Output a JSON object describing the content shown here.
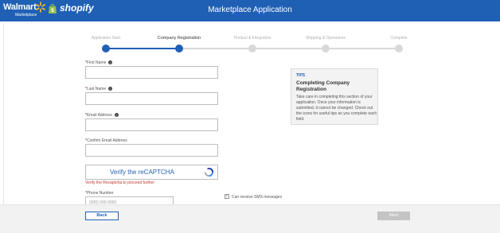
{
  "header": {
    "walmart_text": "Walmart",
    "walmart_sub": "Marketplace",
    "shopify_text": "shopify",
    "title": "Marketplace Application",
    "bg_color": "#1f60b5"
  },
  "steps": [
    {
      "label": "Application Start",
      "state": "done"
    },
    {
      "label": "Company Registration",
      "state": "active"
    },
    {
      "label": "Product & Integration",
      "state": "pending"
    },
    {
      "label": "Shipping & Operations",
      "state": "pending"
    },
    {
      "label": "Complete",
      "state": "pending"
    }
  ],
  "form": {
    "first_name_label": "First Name",
    "last_name_label": "Last Name",
    "email_label": "Email Address",
    "confirm_email_label": "Confirm Email Address",
    "captcha_text": "Verify the reCAPTCHA",
    "captcha_error": "Verify the Recaptcha to proceed further",
    "phone_label": "Phone Number",
    "phone_placeholder": "(000) 000-0000",
    "sms_label": "Can receive SMS messages",
    "required_mark": "*"
  },
  "tips": {
    "label": "TIPS",
    "title": "Completing Company Registration",
    "body": "Take care in completing this section of your application. Once your information is submitted, it cannot be changed. Check out the icons for useful tips as you complete each field."
  },
  "footer": {
    "back_label": "Back",
    "next_label": "Next"
  },
  "colors": {
    "accent": "#1f60b5",
    "error": "#c0392b",
    "disabled": "#c4c4c4"
  }
}
